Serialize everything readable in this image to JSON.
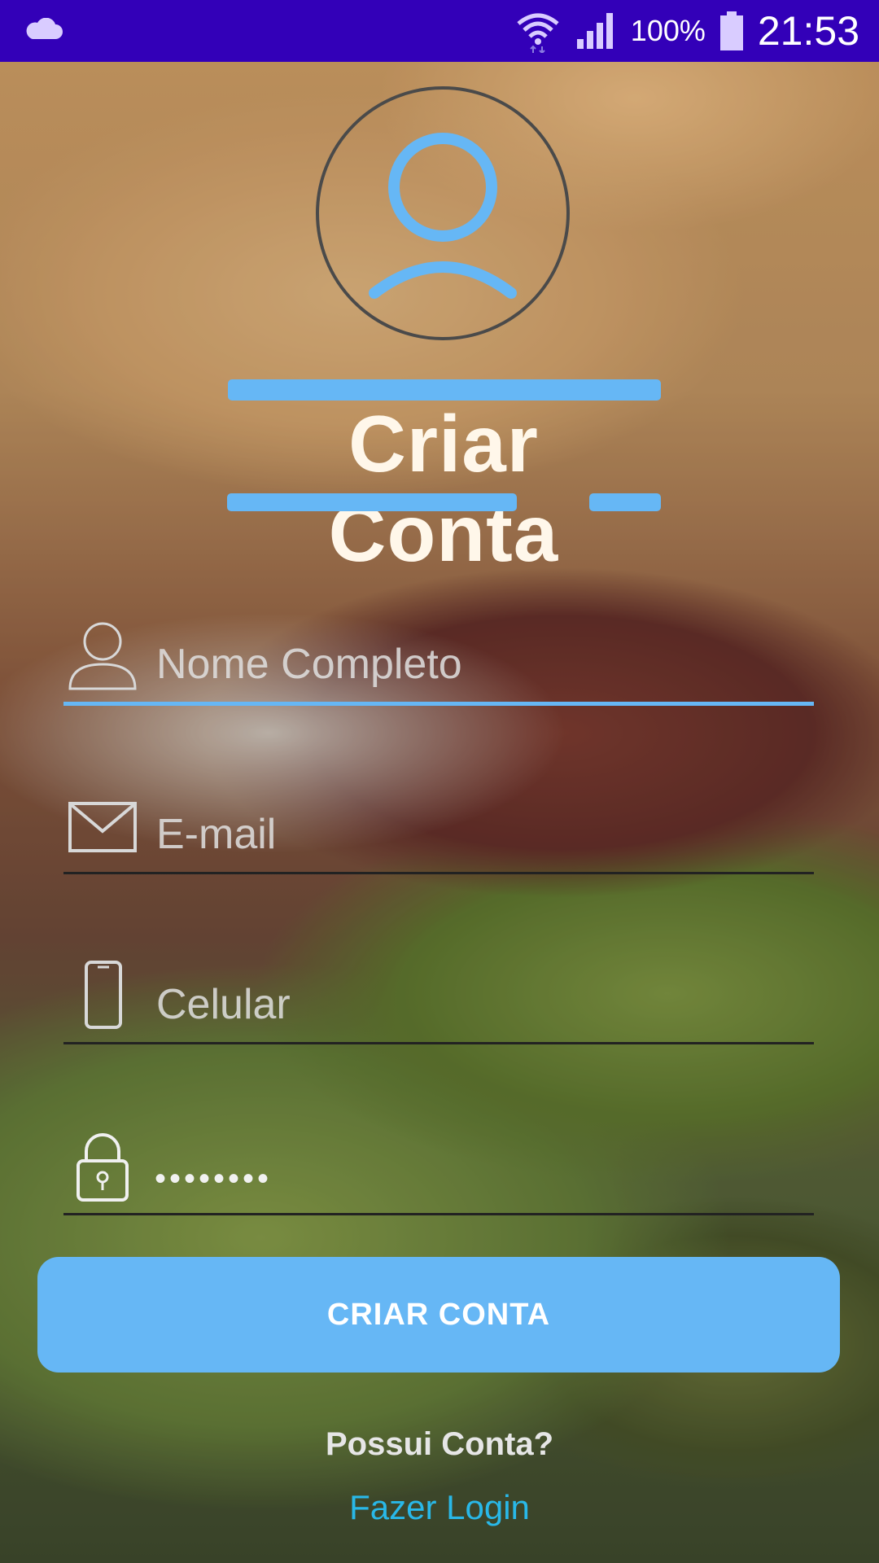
{
  "status_bar": {
    "battery": "100%",
    "time": "21:53",
    "icons": [
      "cloud-icon",
      "wifi-icon",
      "signal-icon",
      "battery-icon"
    ]
  },
  "title": "Criar Conta",
  "form": {
    "name_placeholder": "Nome Completo",
    "email_placeholder": "E-mail",
    "phone_placeholder": "Celular",
    "password_masked": "••••••••"
  },
  "actions": {
    "create_button": "CRIAR CONTA",
    "have_account": "Possui Conta?",
    "login_link": "Fazer Login"
  },
  "colors": {
    "status_bar": "#3300b8",
    "accent": "#66b7f5",
    "link": "#29b8e8"
  }
}
